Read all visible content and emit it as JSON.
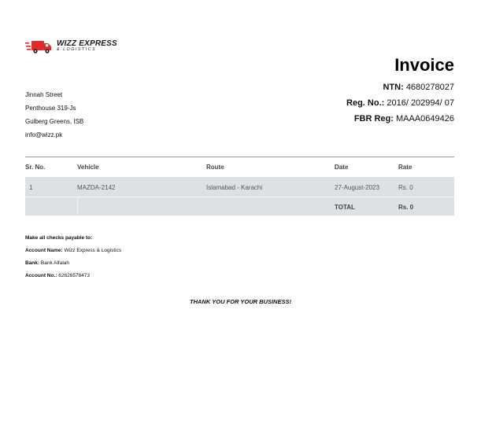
{
  "company": {
    "logo_title": "WIZZ EXPRESS",
    "logo_subtitle": "& LOGISTICS",
    "address_lines": [
      "Jinnah Street",
      "Penthouse 319-Js",
      "Gulberg Greens, ISB",
      "info@wizz.pk"
    ],
    "brand_color": "#e02b2b"
  },
  "invoice": {
    "title": "Invoice",
    "ntn_label": "NTN:",
    "ntn_value": "4680278027",
    "reg_label": "Reg. No.:",
    "reg_value": "2016/ 202994/ 07",
    "fbr_label": "FBR Reg:",
    "fbr_value": "MAAA0649426"
  },
  "table": {
    "headers": [
      "Sr. No.",
      "Vehicle",
      "Route",
      "Date",
      "Rate"
    ],
    "rows": [
      [
        "1",
        "MAZDA-2142",
        "Islamabad - Karachi",
        "27-August-2023",
        "Rs. 0"
      ]
    ],
    "total_label": "TOTAL",
    "total_value": "Rs. 0"
  },
  "payment": {
    "heading": "Make all checks payable to:",
    "account_name_label": "Account Name:",
    "account_name": "Wizz Express & Logistics",
    "bank_label": "Bank:",
    "bank": "Bank Alfalah",
    "account_no_label": "Account No.:",
    "account_no": "62626578473"
  },
  "footer": {
    "thanks": "THANK YOU FOR YOUR BUSINESS!"
  }
}
